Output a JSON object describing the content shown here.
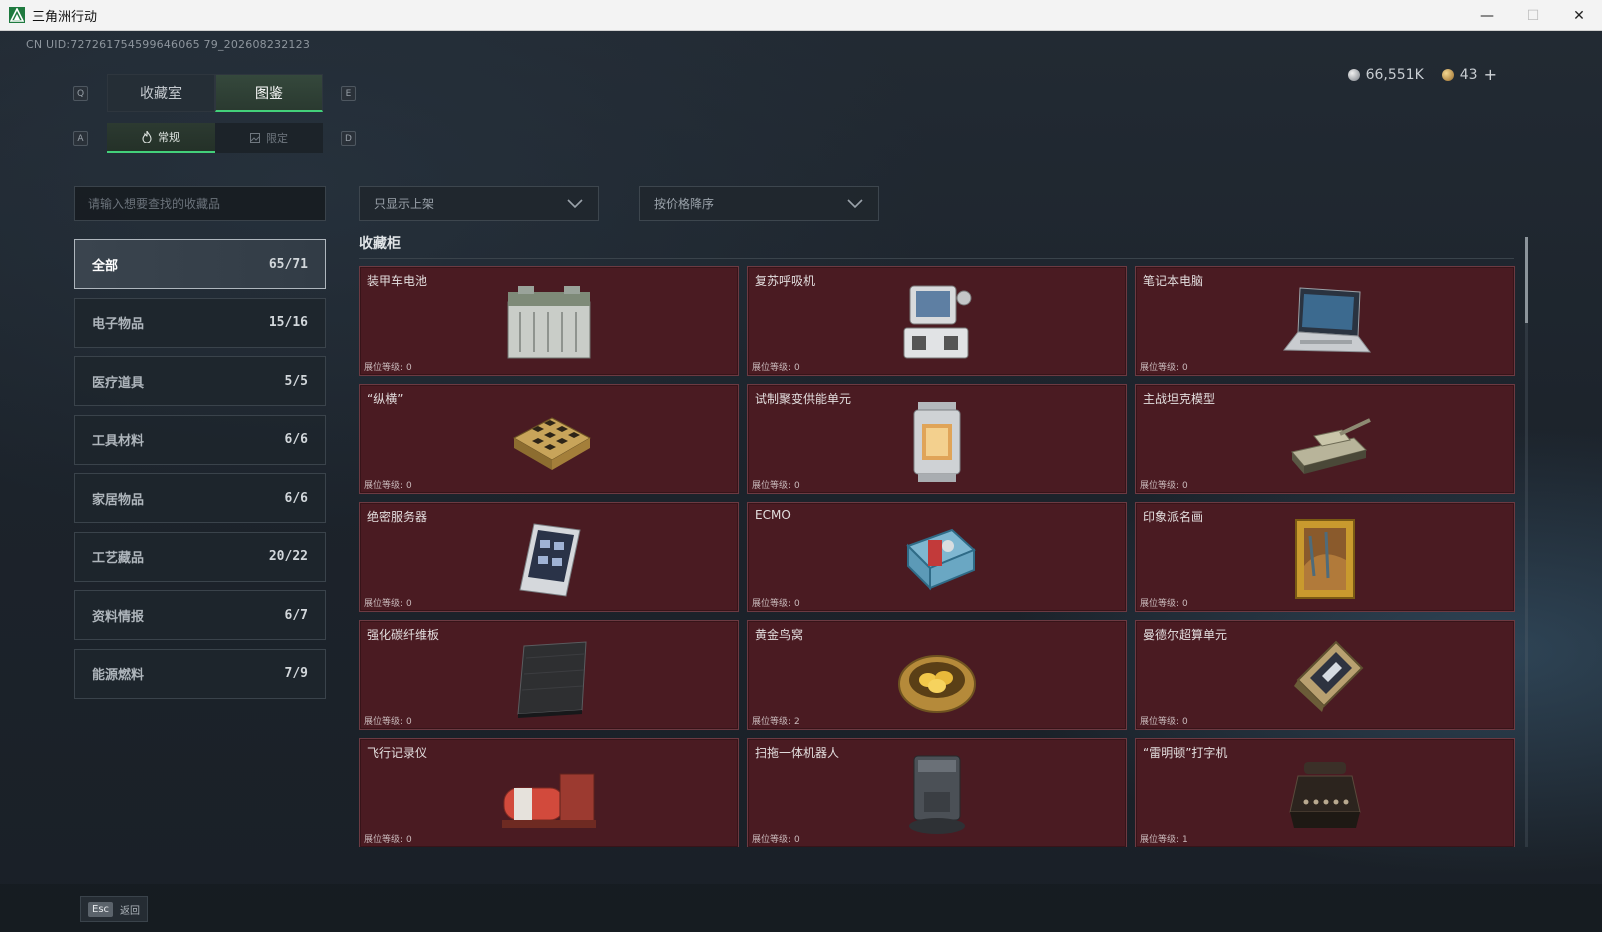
{
  "window": {
    "title": "三角洲行动",
    "minimize": "—",
    "maximize": "☐",
    "close": "✕"
  },
  "header": {
    "uid": "CN UID:727261754599646065 79_202608232123",
    "currency": [
      {
        "icon": "silver-coin-icon",
        "value": "66,551K"
      },
      {
        "icon": "gold-coin-icon",
        "value": "43"
      }
    ],
    "currency_plus": "+"
  },
  "tabs": {
    "key_prev": "Q",
    "key_next": "E",
    "items": [
      {
        "label": "收藏室",
        "active": false
      },
      {
        "label": "图鉴",
        "active": true
      }
    ]
  },
  "subtabs": {
    "key_prev": "A",
    "key_next": "D",
    "items": [
      {
        "label": "常规",
        "active": true,
        "icon": "flame-icon"
      },
      {
        "label": "限定",
        "active": false,
        "icon": "image-icon"
      }
    ]
  },
  "search": {
    "placeholder": "请输入想要查找的收藏品",
    "value": ""
  },
  "filters": {
    "shelf": "只显示上架",
    "sort": "按价格降序"
  },
  "categories": [
    {
      "label": "全部",
      "count": "65/71",
      "active": true
    },
    {
      "label": "电子物品",
      "count": "15/16"
    },
    {
      "label": "医疗道具",
      "count": "5/5"
    },
    {
      "label": "工具材料",
      "count": "6/6"
    },
    {
      "label": "家居物品",
      "count": "6/6"
    },
    {
      "label": "工艺藏品",
      "count": "20/22"
    },
    {
      "label": "资料情报",
      "count": "6/7"
    },
    {
      "label": "能源燃料",
      "count": "7/9"
    }
  ],
  "section": {
    "title": "收藏柜",
    "level_label": "展位等级:"
  },
  "items": [
    {
      "name": "装甲车电池",
      "level": "0",
      "icon": "battery-icon"
    },
    {
      "name": "复苏呼吸机",
      "level": "0",
      "icon": "ventilator-icon"
    },
    {
      "name": "笔记本电脑",
      "level": "0",
      "icon": "laptop-icon"
    },
    {
      "name": "“纵横”",
      "level": "0",
      "icon": "chessboard-icon"
    },
    {
      "name": "试制聚变供能单元",
      "level": "0",
      "icon": "fusion-unit-icon"
    },
    {
      "name": "主战坦克模型",
      "level": "0",
      "icon": "tank-model-icon"
    },
    {
      "name": "绝密服务器",
      "level": "0",
      "icon": "server-icon"
    },
    {
      "name": "ECMO",
      "level": "0",
      "icon": "ecmo-icon"
    },
    {
      "name": "印象派名画",
      "level": "0",
      "icon": "painting-icon"
    },
    {
      "name": "强化碳纤维板",
      "level": "0",
      "icon": "carbon-plate-icon"
    },
    {
      "name": "黄金鸟窝",
      "level": "2",
      "icon": "golden-nest-icon"
    },
    {
      "name": "曼德尔超算单元",
      "level": "0",
      "icon": "supercompute-icon"
    },
    {
      "name": "飞行记录仪",
      "level": "0",
      "icon": "flight-recorder-icon"
    },
    {
      "name": "扫拖一体机器人",
      "level": "0",
      "icon": "robot-vacuum-icon"
    },
    {
      "name": "“雷明顿”打字机",
      "level": "1",
      "icon": "typewriter-icon"
    }
  ],
  "footer": {
    "esc_key": "Esc",
    "esc_label": "返回"
  },
  "colors": {
    "accent": "#43d07a",
    "card_bg": "#4a1b22",
    "card_border": "#6c3a42"
  }
}
